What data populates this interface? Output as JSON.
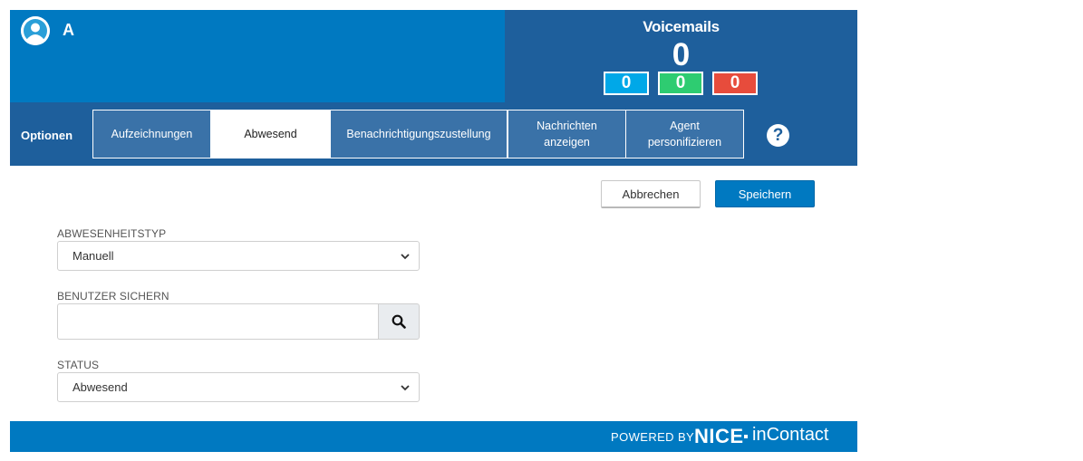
{
  "header": {
    "user_name": "A",
    "voicemails": {
      "title": "Voicemails",
      "total": "0",
      "badges": [
        "0",
        "0",
        "0"
      ]
    }
  },
  "nav": {
    "label": "Optionen",
    "tabs": [
      {
        "label": "Aufzeichnungen",
        "active": false
      },
      {
        "label": "Abwesend",
        "active": true
      },
      {
        "label": "Benachrichtigungszustellung",
        "active": false
      },
      {
        "label": "Nachrichten anzeigen",
        "active": false
      },
      {
        "label": "Agent personifizieren",
        "active": false
      }
    ],
    "help": "?"
  },
  "actions": {
    "cancel_label": "Abbrechen",
    "save_label": "Speichern"
  },
  "form": {
    "absence_type": {
      "label": "ABWESENHEITSTYP",
      "value": "Manuell"
    },
    "backup_user": {
      "label": "BENUTZER SICHERN",
      "value": ""
    },
    "status": {
      "label": "STATUS",
      "value": "Abwesend"
    }
  },
  "footer": {
    "powered_by": "POWERED BY",
    "brand_nice": "NICE",
    "brand_incontact": "inContact"
  },
  "colors": {
    "primary_blue": "#0079c1",
    "dark_blue": "#1e5f9c",
    "badge_blue": "#00a8e8",
    "badge_green": "#2ecc71",
    "badge_red": "#e74c3c"
  }
}
